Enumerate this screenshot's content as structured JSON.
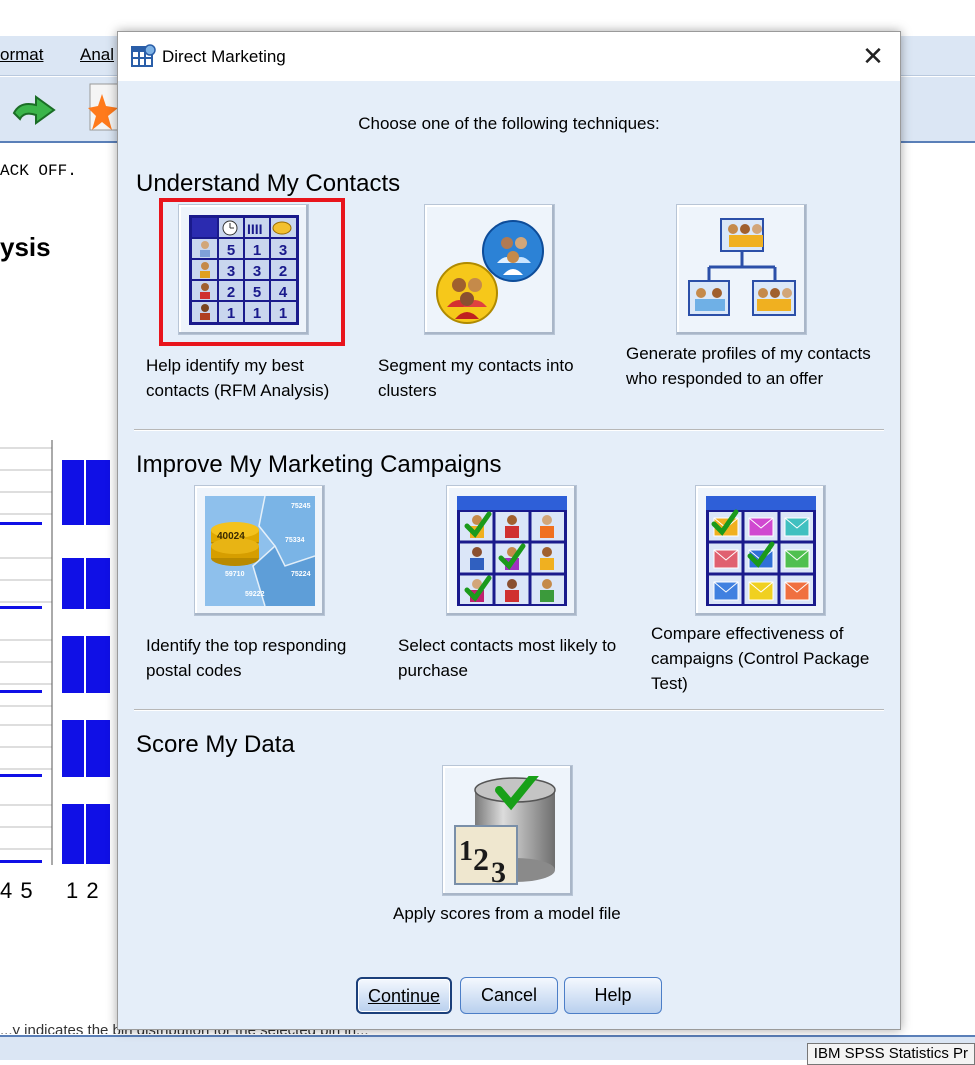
{
  "background": {
    "menu": [
      "ormat",
      "Anal"
    ],
    "syntax_text": "ACK OFF.",
    "heading": "ysis",
    "axis_left": "4 5",
    "axis_right": "1 2",
    "bottom_text": "...y indicates the bin distribution for the selected bin in...",
    "status": "IBM SPSS Statistics Pr"
  },
  "dialog": {
    "title": "Direct Marketing",
    "prompt": "Choose one of the following techniques:",
    "sections": [
      {
        "title": "Understand My Contacts",
        "items": [
          {
            "label": "Help identify my best contacts (RFM Analysis)",
            "icon": "rfm-grid-icon",
            "selected": true,
            "grid": [
              "5",
              "1",
              "3",
              "3",
              "3",
              "2",
              "2",
              "5",
              "4",
              "1",
              "1",
              "1"
            ]
          },
          {
            "label": "Segment my contacts into clusters",
            "icon": "clusters-icon"
          },
          {
            "label": "Generate profiles of my contacts who responded to an offer",
            "icon": "profiles-tree-icon"
          }
        ]
      },
      {
        "title": "Improve My Marketing Campaigns",
        "items": [
          {
            "label": "Identify the top responding postal codes",
            "icon": "postal-codes-map-icon",
            "codes": [
              "75245",
              "40024",
              "75334",
              "59710",
              "75224",
              "59222"
            ]
          },
          {
            "label": "Select contacts most likely to purchase",
            "icon": "contacts-grid-icon"
          },
          {
            "label": "Compare effectiveness of campaigns (Control Package Test)",
            "icon": "envelopes-grid-icon"
          }
        ]
      },
      {
        "title": "Score My Data",
        "items": [
          {
            "label": "Apply scores from a model file",
            "icon": "score-database-icon",
            "glyph": "123"
          }
        ]
      }
    ],
    "buttons": {
      "continue": "Continue",
      "cancel": "Cancel",
      "help": "Help"
    }
  },
  "colors": {
    "dialog_bg": "#e5eef9",
    "highlight": "#e8141c",
    "chart_bar": "#1010e6",
    "title_bar": "#ffffff"
  }
}
